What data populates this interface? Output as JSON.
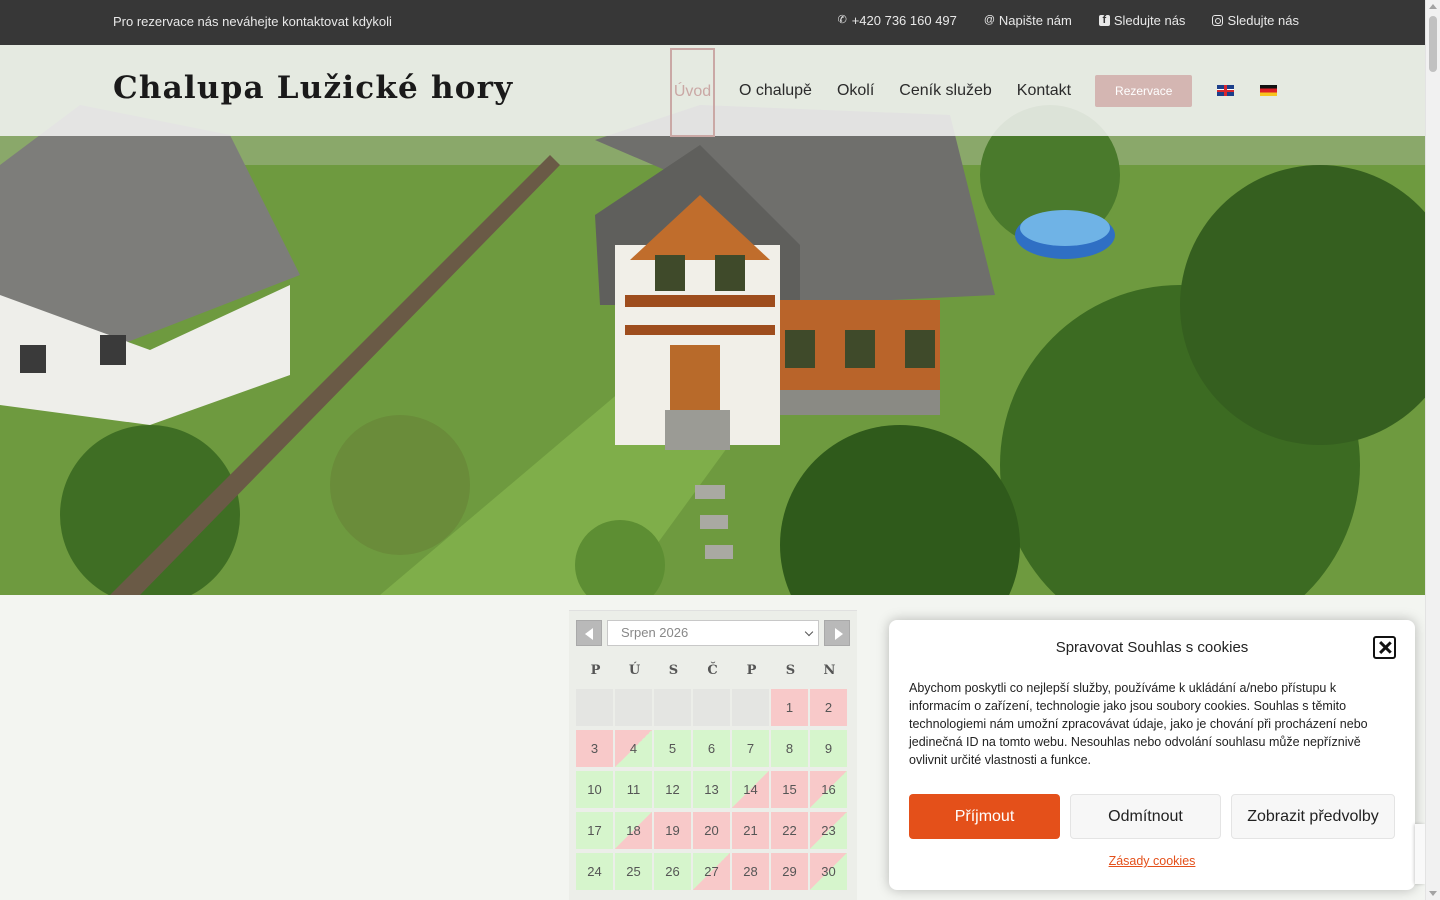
{
  "topbar": {
    "message": "Pro rezervace nás neváhejte kontaktovat kdykoli",
    "phone": "+420 736 160 497",
    "email_label": "Napište nám",
    "facebook_label": "Sledujte nás",
    "instagram_label": "Sledujte nás"
  },
  "header": {
    "logo": "Chalupa Lužické hory",
    "nav": [
      "Úvod",
      "O chalupě",
      "Okolí",
      "Ceník služeb",
      "Kontakt"
    ],
    "reserve_label": "Rezervace",
    "languages": [
      "en-flag-icon",
      "de-flag-icon"
    ]
  },
  "calendar": {
    "month": "Srpen 2026",
    "weekdays": [
      "P",
      "Ú",
      "S",
      "Č",
      "P",
      "S",
      "N"
    ],
    "days": [
      {
        "d": "",
        "s": "empty"
      },
      {
        "d": "",
        "s": "empty"
      },
      {
        "d": "",
        "s": "empty"
      },
      {
        "d": "",
        "s": "empty"
      },
      {
        "d": "",
        "s": "empty"
      },
      {
        "d": "1",
        "s": "booked"
      },
      {
        "d": "2",
        "s": "booked"
      },
      {
        "d": "3",
        "s": "booked"
      },
      {
        "d": "4",
        "s": "out"
      },
      {
        "d": "5",
        "s": "free"
      },
      {
        "d": "6",
        "s": "free"
      },
      {
        "d": "7",
        "s": "free"
      },
      {
        "d": "8",
        "s": "free"
      },
      {
        "d": "9",
        "s": "free"
      },
      {
        "d": "10",
        "s": "free"
      },
      {
        "d": "11",
        "s": "free"
      },
      {
        "d": "12",
        "s": "free"
      },
      {
        "d": "13",
        "s": "free"
      },
      {
        "d": "14",
        "s": "in"
      },
      {
        "d": "15",
        "s": "booked"
      },
      {
        "d": "16",
        "s": "out"
      },
      {
        "d": "17",
        "s": "free"
      },
      {
        "d": "18",
        "s": "in"
      },
      {
        "d": "19",
        "s": "booked"
      },
      {
        "d": "20",
        "s": "booked"
      },
      {
        "d": "21",
        "s": "booked"
      },
      {
        "d": "22",
        "s": "booked"
      },
      {
        "d": "23",
        "s": "out"
      },
      {
        "d": "24",
        "s": "free"
      },
      {
        "d": "25",
        "s": "free"
      },
      {
        "d": "26",
        "s": "free"
      },
      {
        "d": "27",
        "s": "in"
      },
      {
        "d": "28",
        "s": "booked"
      },
      {
        "d": "29",
        "s": "booked"
      },
      {
        "d": "30",
        "s": "out"
      }
    ]
  },
  "cookie": {
    "title": "Spravovat Souhlas s cookies",
    "text": "Abychom poskytli co nejlepší služby, používáme k ukládání a/nebo přístupu k informacím o zařízení, technologie jako jsou soubory cookies. Souhlas s těmito technologiemi nám umožní zpracovávat údaje, jako je chování při procházení nebo jedinečná ID na tomto webu. Nesouhlas nebo odvolání souhlasu může nepříznivě ovlivnit určité vlastnosti a funkce.",
    "accept": "Příjmout",
    "deny": "Odmítnout",
    "prefs": "Zobrazit předvolby",
    "policy": "Zásady cookies"
  },
  "colors": {
    "accent": "#e4501a",
    "nav_active": "#caa8a5",
    "reserve_button": "#d4b6b2",
    "free_day": "#d6f5cc",
    "booked_day": "#f8c9c9"
  }
}
